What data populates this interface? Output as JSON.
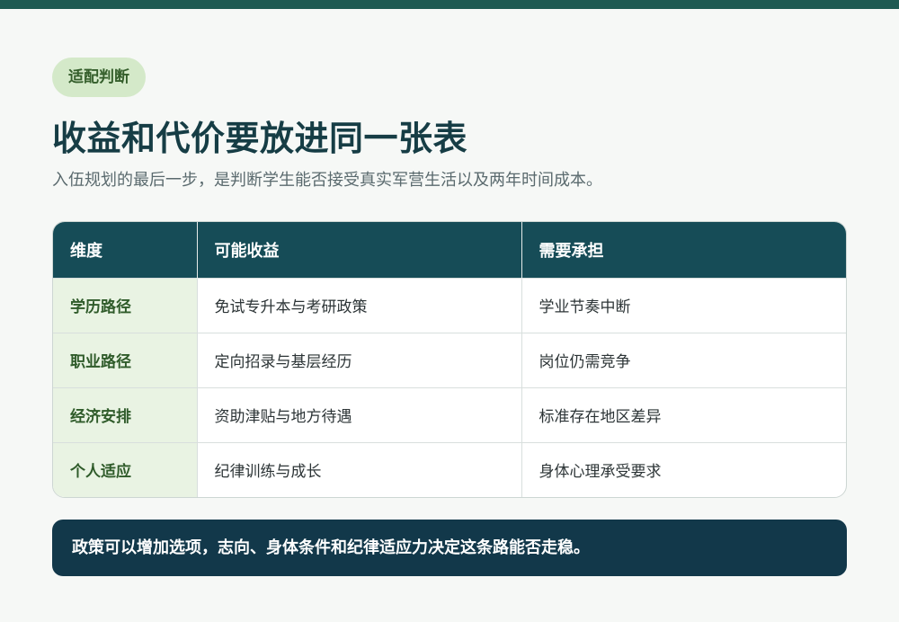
{
  "tag": "适配判断",
  "title": "收益和代价要放进同一张表",
  "subtitle": "入伍规划的最后一步，是判断学生能否接受真实军营生活以及两年时间成本。",
  "table": {
    "headers": [
      "维度",
      "可能收益",
      "需要承担"
    ],
    "rows": [
      [
        "学历路径",
        "免试专升本与考研政策",
        "学业节奏中断"
      ],
      [
        "职业路径",
        "定向招录与基层经历",
        "岗位仍需竞争"
      ],
      [
        "经济安排",
        "资助津贴与地方待遇",
        "标准存在地区差异"
      ],
      [
        "个人适应",
        "纪律训练与成长",
        "身体心理承受要求"
      ]
    ]
  },
  "note": "政策可以增加选项，志向、身体条件和纪律适应力决定这条路能否走稳。",
  "colors": {
    "accent": "#1e5a52",
    "header_bg": "#164c57",
    "tag_bg": "#d4e9c9",
    "note_bg": "#12384a"
  }
}
